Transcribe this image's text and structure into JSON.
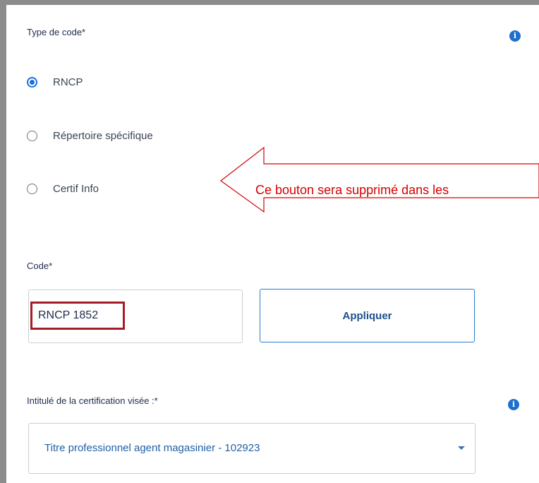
{
  "type_code": {
    "label": "Type de code*",
    "options": [
      {
        "label": "RNCP",
        "checked": true
      },
      {
        "label": "Répertoire spécifique",
        "checked": false
      },
      {
        "label": "Certif Info",
        "checked": false
      }
    ]
  },
  "info_icon": {
    "glyph": "i",
    "icon": "info-icon",
    "color": "#1f6fce"
  },
  "annotation": {
    "text": "Ce bouton sera supprimé dans les",
    "color": "#d60000"
  },
  "code": {
    "label": "Code*",
    "value": "RNCP 1852",
    "highlight_color": "#a51d24"
  },
  "apply_button": {
    "label": "Appliquer"
  },
  "certification": {
    "label": "Intitulé de la certification visée :*",
    "selected": "Titre professionnel agent magasinier - 102923"
  }
}
